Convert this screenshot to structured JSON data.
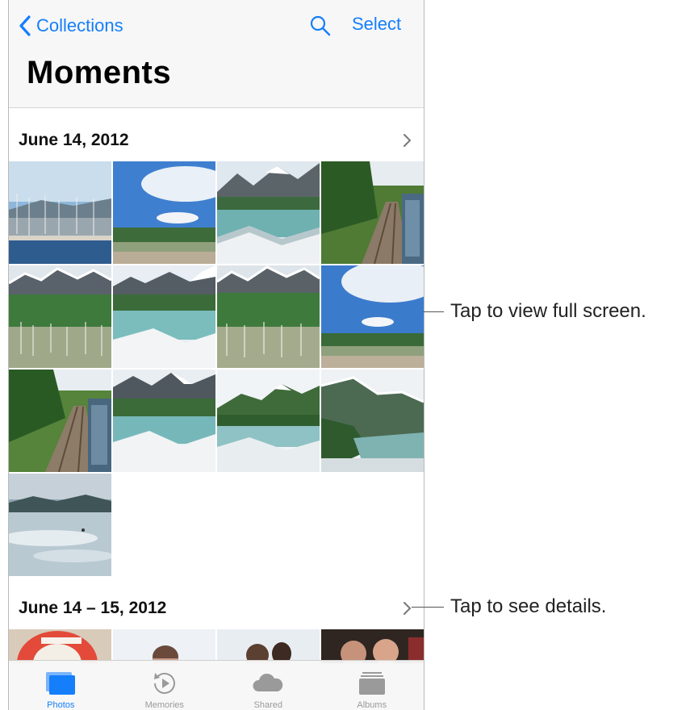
{
  "nav": {
    "back_label": "Collections",
    "select_label": "Select",
    "title": "Moments"
  },
  "sections": [
    {
      "date": "June 14, 2012"
    },
    {
      "date": "June 14 – 15, 2012"
    }
  ],
  "tabs": [
    {
      "label": "Photos",
      "icon": "photos-icon",
      "active": true
    },
    {
      "label": "Memories",
      "icon": "memories-icon",
      "active": false
    },
    {
      "label": "Shared",
      "icon": "cloud-icon",
      "active": false
    },
    {
      "label": "Albums",
      "icon": "albums-icon",
      "active": false
    }
  ],
  "callouts": [
    {
      "text": "Tap to view full screen."
    },
    {
      "text": "Tap to see details."
    }
  ],
  "colors": {
    "accent": "#157efb"
  }
}
